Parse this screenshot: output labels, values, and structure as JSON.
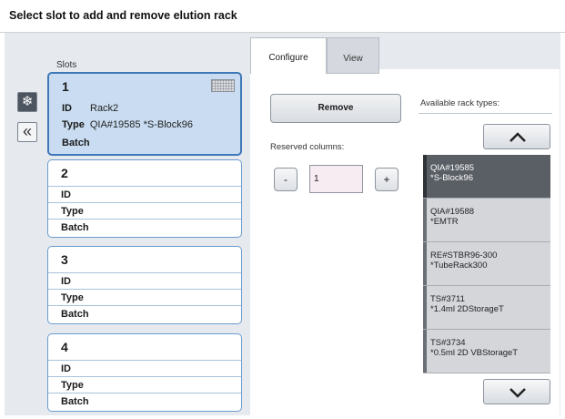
{
  "header": {
    "title": "Select slot to add and remove elution rack"
  },
  "slots_label": "Slots",
  "side_buttons": {
    "cold_icon": "snowflake-icon",
    "collapse_icon": "double-chevron-left-icon"
  },
  "slots": [
    {
      "number": "1",
      "id_label": "ID",
      "id_value": "Rack2",
      "type_label": "Type",
      "type_value": "QIA#19585 *S-Block96",
      "batch_label": "Batch",
      "batch_value": ""
    },
    {
      "number": "2",
      "id_label": "ID",
      "id_value": "",
      "type_label": "Type",
      "type_value": "",
      "batch_label": "Batch",
      "batch_value": ""
    },
    {
      "number": "3",
      "id_label": "ID",
      "id_value": "",
      "type_label": "Type",
      "type_value": "",
      "batch_label": "Batch",
      "batch_value": ""
    },
    {
      "number": "4",
      "id_label": "ID",
      "id_value": "",
      "type_label": "Type",
      "type_value": "",
      "batch_label": "Batch",
      "batch_value": ""
    }
  ],
  "tabs": [
    {
      "label": "Configure",
      "active": true
    },
    {
      "label": "View",
      "active": false
    }
  ],
  "configure": {
    "remove_label": "Remove",
    "reserved_label": "Reserved columns:",
    "minus_label": "-",
    "plus_label": "+",
    "reserved_value": "1"
  },
  "available": {
    "label": "Available rack types:",
    "items": [
      {
        "line1": "QIA#19585",
        "line2": "*S-Block96",
        "selected": true
      },
      {
        "line1": "QIA#19588",
        "line2": "*EMTR",
        "selected": false
      },
      {
        "line1": "RE#STBR96-300",
        "line2": "*TubeRack300",
        "selected": false
      },
      {
        "line1": "TS#3711",
        "line2": "*1.4ml 2DStorageT",
        "selected": false
      },
      {
        "line1": "TS#3734",
        "line2": "*0.5ml 2D VBStorageT",
        "selected": false
      }
    ]
  },
  "colors": {
    "slot_selected": "#c9dcf1",
    "slot_border": "#6b9ccf",
    "rack_selected": "#5a5f66"
  }
}
